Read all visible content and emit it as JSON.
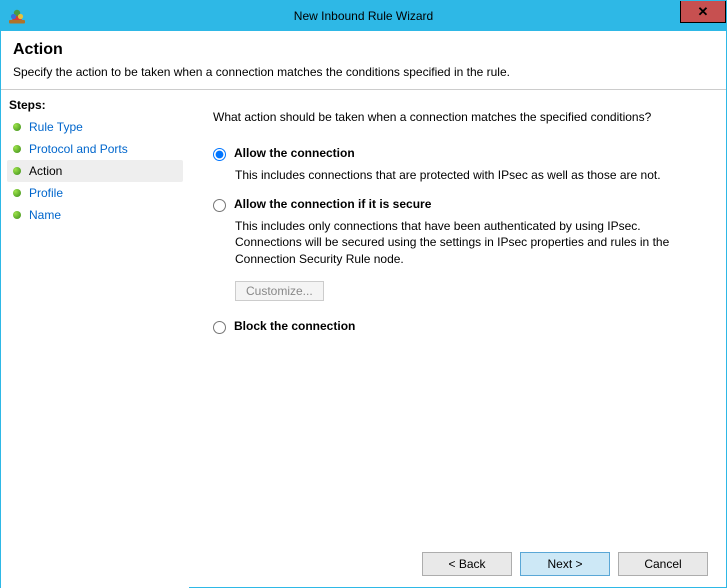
{
  "window": {
    "title": "New Inbound Rule Wizard",
    "close_label": "✕"
  },
  "header": {
    "title": "Action",
    "description": "Specify the action to be taken when a connection matches the conditions specified in the rule."
  },
  "steps": {
    "title": "Steps:",
    "items": [
      {
        "label": "Rule Type",
        "current": false
      },
      {
        "label": "Protocol and Ports",
        "current": false
      },
      {
        "label": "Action",
        "current": true
      },
      {
        "label": "Profile",
        "current": false
      },
      {
        "label": "Name",
        "current": false
      }
    ]
  },
  "main": {
    "question": "What action should be taken when a connection matches the specified conditions?",
    "options": [
      {
        "id": "allow",
        "label": "Allow the connection",
        "description": "This includes connections that are protected with IPsec as well as those are not.",
        "checked": true
      },
      {
        "id": "allow-secure",
        "label": "Allow the connection if it is secure",
        "description": "This includes only connections that have been authenticated by using IPsec.  Connections will be secured using the settings in IPsec properties and rules in the Connection Security Rule node.",
        "checked": false,
        "customize_label": "Customize..."
      },
      {
        "id": "block",
        "label": "Block the connection",
        "checked": false
      }
    ]
  },
  "buttons": {
    "back": "< Back",
    "next": "Next >",
    "cancel": "Cancel"
  }
}
